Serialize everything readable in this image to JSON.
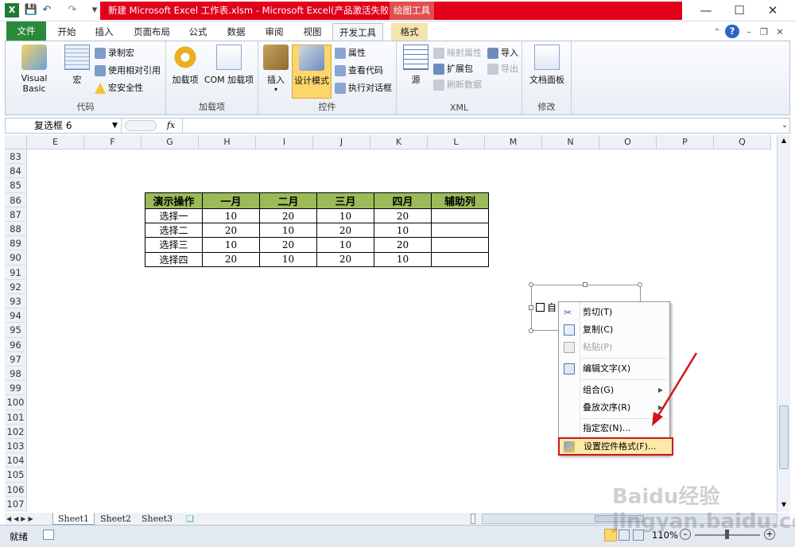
{
  "title": {
    "text": "新建 Microsoft Excel 工作表.xlsm - Microsoft Excel(产品激活失败)",
    "context_tab": "绘图工具"
  },
  "tabs": [
    "文件",
    "开始",
    "插入",
    "页面布局",
    "公式",
    "数据",
    "审阅",
    "视图",
    "开发工具",
    "格式"
  ],
  "ribbon": {
    "code": {
      "label": "代码",
      "vb": "Visual Basic",
      "macro": "宏",
      "record": "录制宏",
      "relative": "使用相对引用",
      "security": "宏安全性"
    },
    "addins": {
      "label": "加载项",
      "addins": "加载项",
      "com": "COM 加载项"
    },
    "controls": {
      "label": "控件",
      "insert": "插入",
      "design": "设计模式",
      "props": "属性",
      "viewcode": "查看代码",
      "rundialog": "执行对话框"
    },
    "xml": {
      "label": "XML",
      "source": "源",
      "mapprops": "映射属性",
      "expansion": "扩展包",
      "refresh": "刷新数据",
      "import": "导入",
      "export": "导出"
    },
    "modify": {
      "label": "修改",
      "docpanel": "文档面板"
    }
  },
  "formula": {
    "namebox": "复选框 6",
    "fx": "fx",
    "value": ""
  },
  "columns": [
    "E",
    "F",
    "G",
    "H",
    "I",
    "J",
    "K",
    "L",
    "M",
    "N",
    "O",
    "P",
    "Q"
  ],
  "rows": [
    "83",
    "84",
    "85",
    "86",
    "87",
    "88",
    "89",
    "90",
    "91",
    "92",
    "93",
    "94",
    "95",
    "96",
    "97",
    "98",
    "99",
    "100",
    "101",
    "102",
    "103",
    "104",
    "105",
    "106",
    "107"
  ],
  "table": {
    "headers": [
      "演示操作",
      "一月",
      "二月",
      "三月",
      "四月",
      "辅助列"
    ],
    "rows": [
      [
        "选择一",
        "10",
        "20",
        "10",
        "20",
        ""
      ],
      [
        "选择二",
        "20",
        "10",
        "20",
        "10",
        ""
      ],
      [
        "选择三",
        "10",
        "20",
        "10",
        "20",
        ""
      ],
      [
        "选择四",
        "20",
        "10",
        "20",
        "10",
        ""
      ]
    ]
  },
  "checkbox_partial": "自",
  "menu": {
    "cut": "剪切(T)",
    "copy": "复制(C)",
    "paste": "粘贴(P)",
    "edittext": "编辑文字(X)",
    "group": "组合(G)",
    "order": "叠放次序(R)",
    "assign": "指定宏(N)...",
    "format": "设置控件格式(F)..."
  },
  "sheets": [
    "Sheet1",
    "Sheet2",
    "Sheet3"
  ],
  "status": {
    "ready": "就绪",
    "zoom": "110%"
  },
  "watermark": "Baidu经验 jingyan.baidu.com",
  "colors": {
    "accent": "#e0001a",
    "file_tab": "#2a8a3a",
    "table_header": "#9bbb59",
    "highlight": "#d0141c"
  }
}
